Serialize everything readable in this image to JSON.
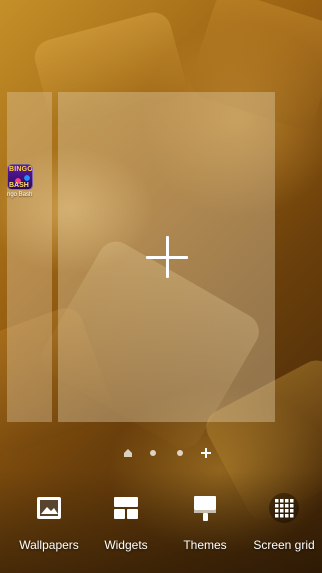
{
  "pages": {
    "left_page": {
      "apps": [
        {
          "icon_text_top": "BINGO",
          "icon_text_bottom": "BASH",
          "label": "ngo Bash",
          "icon": "bingo-bash-app-icon"
        }
      ]
    },
    "add_page": {
      "icon": "plus-icon"
    }
  },
  "indicators": {
    "items": [
      {
        "type": "home",
        "icon": "home-indicator-icon"
      },
      {
        "type": "dot",
        "icon": "page-dot-icon"
      },
      {
        "type": "dot",
        "icon": "page-dot-icon"
      },
      {
        "type": "add",
        "icon": "add-page-indicator-icon"
      }
    ]
  },
  "options": {
    "wallpapers": {
      "label": "Wallpapers",
      "icon": "image-icon"
    },
    "widgets": {
      "label": "Widgets",
      "icon": "widgets-icon"
    },
    "themes": {
      "label": "Themes",
      "icon": "brush-icon"
    },
    "screen_grid": {
      "label": "Screen grid",
      "icon": "grid-icon"
    }
  },
  "colors": {
    "text": "#ffffff",
    "panel_overlay": "#e1cdaa",
    "wallpaper_dark": "#3b2106",
    "wallpaper_light": "#c59028"
  }
}
